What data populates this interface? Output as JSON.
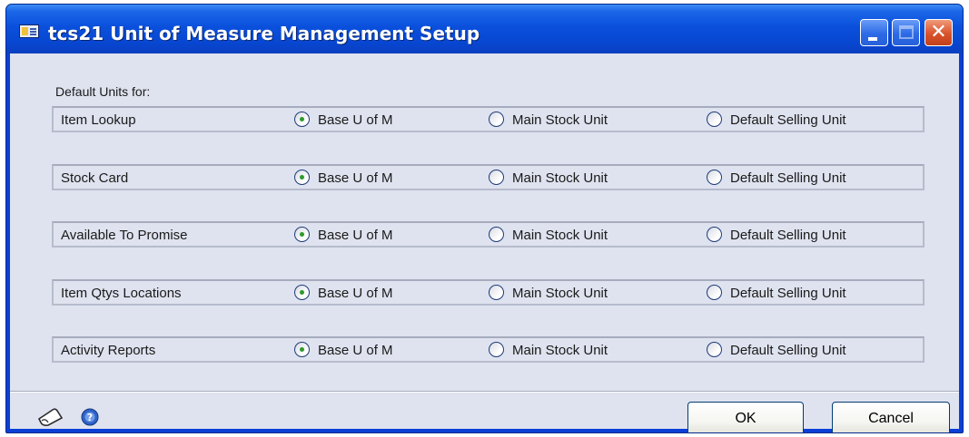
{
  "window": {
    "title": "tcs21 Unit of Measure Management Setup",
    "minimize_icon": "minimize-icon",
    "maximize_icon": "maximize-icon",
    "close_icon": "close-icon",
    "close_glyph": "✕"
  },
  "section": {
    "heading": "Default Units for:"
  },
  "options": {
    "base": "Base U of M",
    "main_stock": "Main Stock Unit",
    "default_selling": "Default Selling Unit"
  },
  "rows": [
    {
      "label": "Item Lookup",
      "selected": "base"
    },
    {
      "label": "Stock Card",
      "selected": "base"
    },
    {
      "label": "Available To Promise",
      "selected": "base"
    },
    {
      "label": "Item Qtys Locations",
      "selected": "base"
    },
    {
      "label": "Activity Reports",
      "selected": "base"
    }
  ],
  "footer": {
    "note_icon": "note-icon",
    "help_icon": "help-icon",
    "ok_label": "OK",
    "cancel_label": "Cancel"
  },
  "colors": {
    "title_bar": "#0a50dc",
    "client_background": "#dfe3ef",
    "radio_selected_dot": "#2f9a2f",
    "close_button": "#d9532b"
  }
}
